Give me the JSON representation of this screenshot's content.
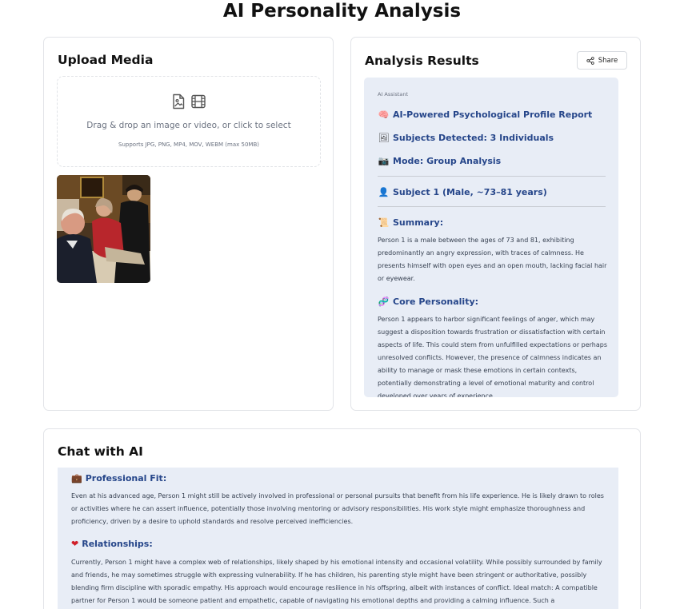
{
  "page": {
    "title": "AI Personality Analysis"
  },
  "upload": {
    "title": "Upload Media",
    "drop_text": "Drag & drop an image or video, or click to select",
    "supports_text": "Supports JPG, PNG, MP4, MOV, WEBM (max 50MB)",
    "icons": [
      "image-icon",
      "film-icon"
    ]
  },
  "results": {
    "title": "Analysis Results",
    "share_label": "Share",
    "assistant_label": "AI Assistant",
    "report_heading": "AI-Powered Psychological Profile Report",
    "subjects_heading": "Subjects Detected: 3 Individuals",
    "mode_heading": "Mode: Group Analysis",
    "subject_heading": "Subject 1 (Male, ~73–81 years)",
    "summary_heading": "Summary:",
    "summary_text": "Person 1 is a male between the ages of 73 and 81, exhibiting predominantly an angry expression, with traces of calmness. He presents himself with open eyes and an open mouth, lacking facial hair or eyewear.",
    "core_heading": "Core Personality:",
    "core_text": "Person 1 appears to harbor significant feelings of anger, which may suggest a disposition towards frustration or dissatisfaction with certain aspects of life. This could stem from unfulfilled expectations or perhaps unresolved conflicts. However, the presence of calmness indicates an ability to manage or mask these emotions in certain contexts, potentially demonstrating a level of emotional maturity and control developed over years of experience."
  },
  "chat": {
    "title": "Chat with AI",
    "professional_heading": "Professional Fit:",
    "professional_text": "Even at his advanced age, Person 1 might still be actively involved in professional or personal pursuits that benefit from his life experience. He is likely drawn to roles or activities where he can assert influence, potentially those involving mentoring or advisory responsibilities. His work style might emphasize thoroughness and proficiency, driven by a desire to uphold standards and resolve perceived inefficiencies.",
    "relationships_heading": "Relationships:",
    "relationships_text": "Currently, Person 1 might have a complex web of relationships, likely shaped by his emotional intensity and occasional volatility. While possibly surrounded by family and friends, he may sometimes struggle with expressing vulnerability. If he has children, his parenting style might have been stringent or authoritative, possibly blending firm discipline with sporadic empathy. His approach would encourage resilience in his offspring, albeit with instances of conflict. Ideal match: A compatible partner for Person 1 would be someone patient and empathetic, capable of navigating his emotional depths and providing a calming influence. Such a"
  },
  "colors": {
    "heading_blue": "#26468a",
    "panel_bg": "#e8edf6"
  }
}
